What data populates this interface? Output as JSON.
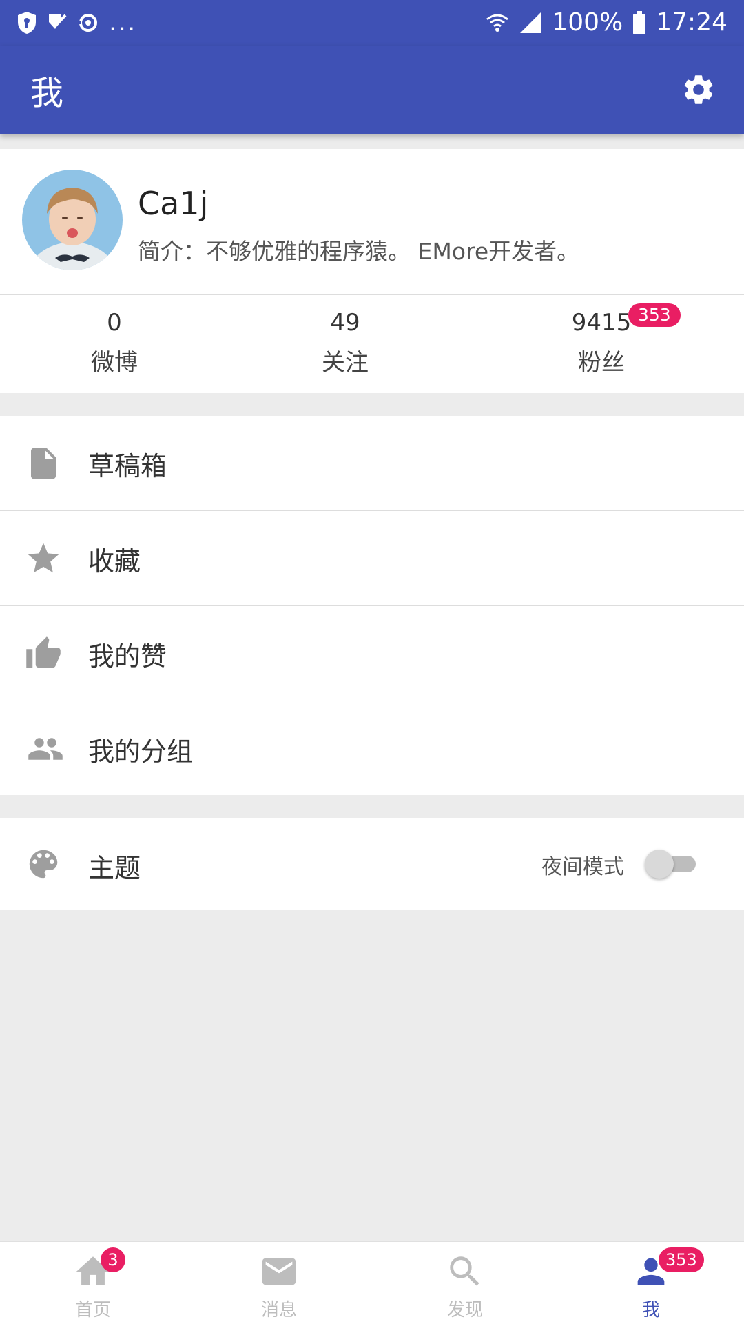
{
  "status_bar": {
    "battery": "100%",
    "time": "17:24",
    "overflow": "..."
  },
  "app_bar": {
    "title": "我",
    "settings_icon": "gear-icon"
  },
  "profile": {
    "name": "Ca1j",
    "bio": "简介：不够优雅的程序猿。 EMore开发者。"
  },
  "stats": [
    {
      "value": "0",
      "label": "微博"
    },
    {
      "value": "49",
      "label": "关注"
    },
    {
      "value": "9415",
      "label": "粉丝",
      "badge": "353"
    }
  ],
  "menu": [
    {
      "label": "草稿箱",
      "icon": "document-icon"
    },
    {
      "label": "收藏",
      "icon": "star-icon"
    },
    {
      "label": "我的赞",
      "icon": "thumb-up-icon"
    },
    {
      "label": "我的分组",
      "icon": "group-icon"
    }
  ],
  "theme": {
    "label": "主题",
    "icon": "palette-icon",
    "night_mode_label": "夜间模式",
    "night_mode_on": false
  },
  "bottom_nav": [
    {
      "label": "首页",
      "icon": "home-icon",
      "badge": "3",
      "active": false
    },
    {
      "label": "消息",
      "icon": "mail-icon",
      "active": false
    },
    {
      "label": "发现",
      "icon": "search-icon",
      "active": false
    },
    {
      "label": "我",
      "icon": "person-icon",
      "badge": "353",
      "active": true
    }
  ],
  "colors": {
    "primary": "#3f51b5",
    "badge": "#e91e63",
    "inactive": "#bdbdbd"
  }
}
